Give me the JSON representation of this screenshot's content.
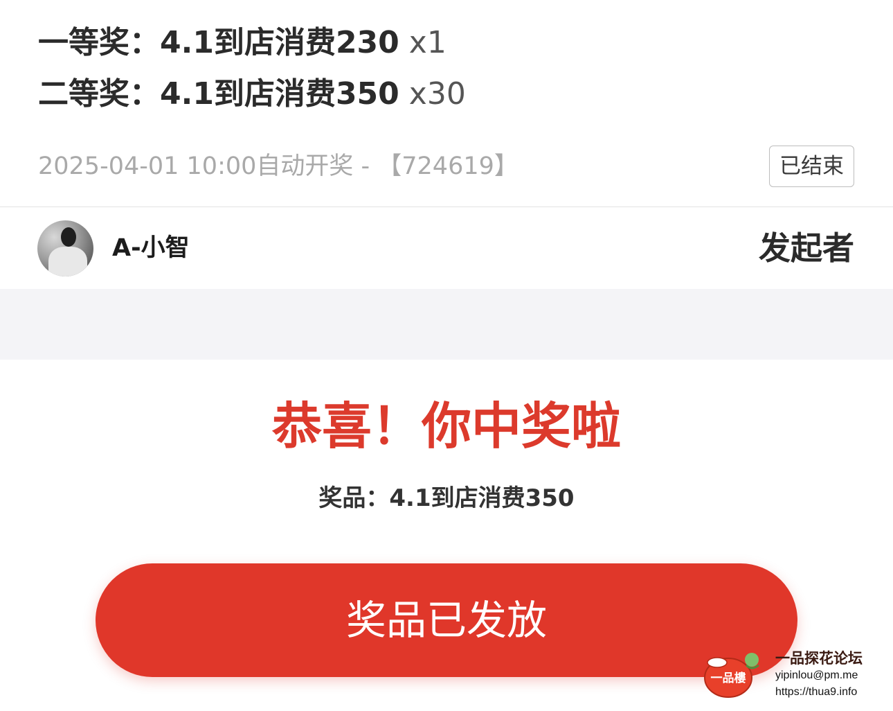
{
  "prizes": [
    {
      "label": "一等奖：4.1到店消费230",
      "qty": "x1"
    },
    {
      "label": "二等奖：4.1到店消费350",
      "qty": "x30"
    }
  ],
  "draw": {
    "info": "2025-04-01 10:00自动开奖 - 【724619】",
    "status": "已结束"
  },
  "initiator": {
    "name": "A-小智",
    "role": "发起者"
  },
  "result": {
    "title": "恭喜！你中奖啦",
    "prize_text": "奖品：4.1到店消费350",
    "button_label": "奖品已发放"
  },
  "watermark": {
    "logo_text": "一品樓",
    "name": "一品探花论坛",
    "email": "yipinlou@pm.me",
    "url": "https://thua9.info"
  },
  "colors": {
    "accent": "#e0372a",
    "title_red": "#dc3a2c",
    "band_gray": "#f4f4f7"
  }
}
